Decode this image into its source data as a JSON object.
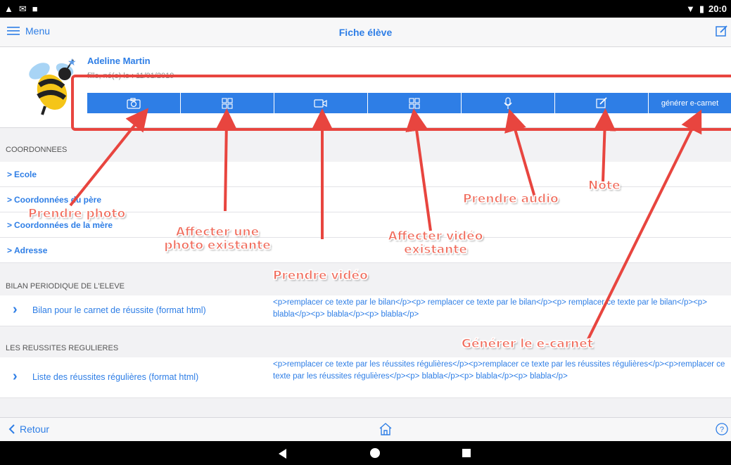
{
  "status_bar": {
    "time": "20:0"
  },
  "nav": {
    "menu_label": "Menu",
    "title": "Fiche élève"
  },
  "student": {
    "name": "Adeline Martin",
    "born": "fille, né(e) le : 11/01/2019"
  },
  "toolbar": {
    "buttons": [
      {
        "icon": "camera-icon"
      },
      {
        "icon": "grid-icon"
      },
      {
        "icon": "video-icon"
      },
      {
        "icon": "grid-icon"
      },
      {
        "icon": "microphone-icon"
      },
      {
        "icon": "edit-note-icon"
      },
      {
        "label": "générer e-carnet"
      }
    ]
  },
  "sections": {
    "coordonnees": {
      "title": "COORDONNEES",
      "rows": [
        "Ecole",
        "Coordonnées du père",
        "Coordonnées de la mère",
        "Adresse"
      ]
    },
    "bilan": {
      "title": "BILAN PERIODIQUE DE L'ELEVE",
      "label": "Bilan pour le carnet de réussite (format html)",
      "value": "<p>remplacer ce texte par le bilan</p><p> remplacer ce texte par le bilan</p><p> remplacer ce texte par le bilan</p><p> blabla</p><p> blabla</p><p> blabla</p>"
    },
    "reussites": {
      "title": "LES REUSSITES REGULIERES",
      "label": "Liste des réussites régulières (format html)",
      "value": "<p>remplacer ce texte par les réussites régulières</p><p>remplacer ce texte par les réussites régulières</p><p>remplacer ce texte par les réussites régulières</p><p> blabla</p><p> blabla</p><p> blabla</p>"
    }
  },
  "bottom": {
    "back_label": "Retour"
  },
  "annotations": {
    "prendre_photo": "Prendre photo",
    "affecter_photo_1": "Affecter une",
    "affecter_photo_2": "photo existante",
    "prendre_video": "Prendre vidéo",
    "affecter_video_1": "Affecter vidéo",
    "affecter_video_2": "existante",
    "prendre_audio": "Prendre audio",
    "note": "Note",
    "generer": "Générer le e-carnet"
  },
  "colors": {
    "accent": "#2e7ee6",
    "annotation": "#e8453f"
  }
}
